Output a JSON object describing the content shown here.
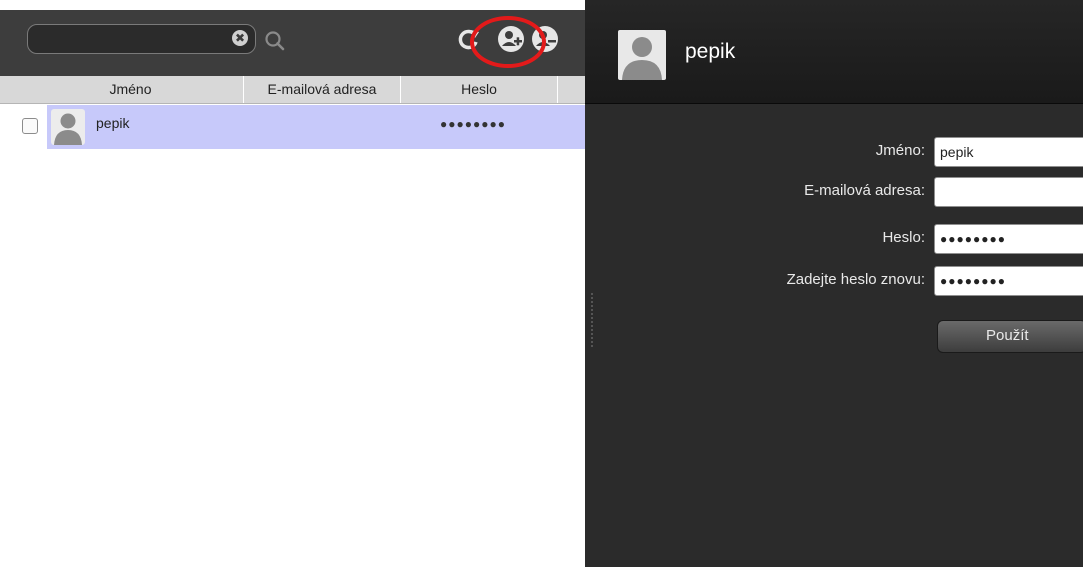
{
  "search": {
    "value": "",
    "clear_glyph": "✖"
  },
  "toolbar_icons": [
    "search-icon",
    "refresh-icon",
    "add-user-icon",
    "remove-user-icon"
  ],
  "table": {
    "columns": [
      "Jméno",
      "E-mailová adresa",
      "Heslo"
    ],
    "rows": [
      {
        "name": "pepik",
        "email": "",
        "password": "●●●●●●●●",
        "selected": true
      }
    ]
  },
  "detail": {
    "title": "pepik",
    "fields": [
      {
        "label": "Jméno:",
        "value": "pepik"
      },
      {
        "label": "E-mailová adresa:",
        "value": ""
      },
      {
        "label": "Heslo:",
        "value": "●●●●●●●●"
      },
      {
        "label": "Zadejte heslo znovu:",
        "value": "●●●●●●●●"
      }
    ],
    "apply_label": "Použít"
  },
  "colors": {
    "toolbar": "#3d3d3d",
    "selected_row": "#c7c9fa",
    "highlight_ring": "#e31a1a",
    "detail_bg": "#2b2b2b"
  }
}
